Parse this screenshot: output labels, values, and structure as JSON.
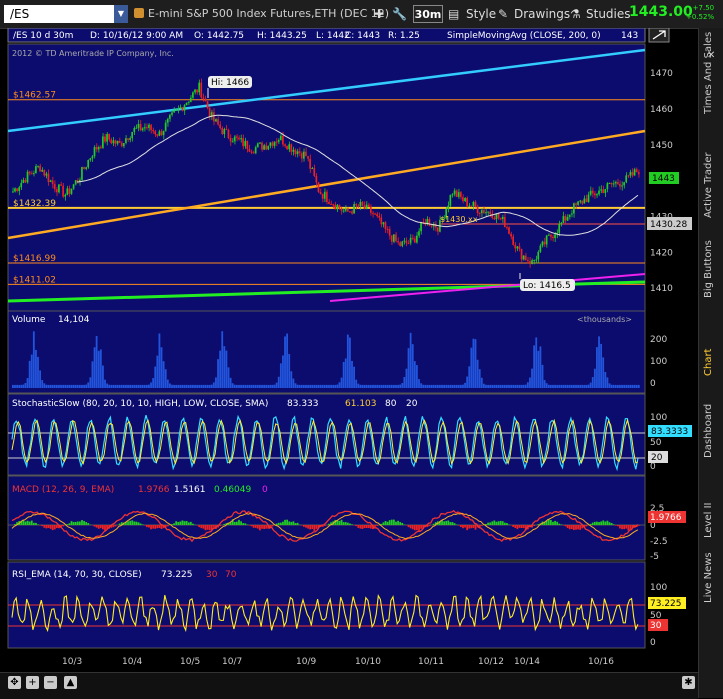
{
  "toolbar": {
    "symbol": "/ES",
    "description": "E-mini S&P 500 Index Futures,ETH (DEC 12)",
    "timeframe": "30m",
    "style_label": "Style",
    "drawings_label": "Drawings",
    "studies_label": "Studies",
    "last_price": "1443.00",
    "change": "+7.50",
    "change_pct": "+0.52%"
  },
  "header_bar": {
    "chart_id": "/ES 10 d 30m",
    "date": "D: 10/16/12 9:00 AM",
    "open": "O: 1442.75",
    "high": "H: 1443.25",
    "low": "L: 1442",
    "close": "C: 1443",
    "range": "R: 1.25",
    "study": "SimpleMovingAvg (CLOSE, 200, 0)",
    "study_value": "143"
  },
  "copyright": "2012 © TD Ameritrade IP Company, Inc.",
  "price_panel": {
    "ylim": [
      1405,
      1477
    ],
    "ticks": [
      1410,
      1420,
      1430,
      1440,
      1450,
      1460,
      1470
    ],
    "hi_label": "Hi: 1466",
    "lo_label": "Lo: 1416.5",
    "levels": [
      {
        "label": "$1462.57",
        "value": 1462.57,
        "color": "#ff8c1a"
      },
      {
        "label": "$1432.39",
        "value": 1432.39,
        "color": "#ffcc33"
      },
      {
        "label": "$1416.99",
        "value": 1416.99,
        "color": "#ff8c1a"
      },
      {
        "label": "$1411.02",
        "value": 1411.02,
        "color": "#ff8c1a"
      }
    ],
    "mid_label": "$1430.xx",
    "current_badge": "1443",
    "sma_badge": "1430.28"
  },
  "volume_panel": {
    "title": "Volume",
    "value": "14,104",
    "units": "<thousands>",
    "ticks": [
      "200",
      "100",
      "0"
    ]
  },
  "stoch_panel": {
    "title": "StochasticSlow (80, 20, 10, 10, HIGH, LOW, CLOSE, SMA)",
    "k": "83.333",
    "d": "61.103",
    "ob": "80",
    "os": "20",
    "badge_k": "83.3333",
    "badge_os": "20",
    "ticks": [
      "100",
      "50",
      "0"
    ]
  },
  "macd_panel": {
    "title": "MACD (12, 26, 9, EMA)",
    "value": "1.9766",
    "avg": "1.5161",
    "diff": "0.46049",
    "zero": "0",
    "badge": "1.9766",
    "ticks": [
      "2.5",
      "0",
      "-2.5",
      "-5"
    ]
  },
  "rsi_panel": {
    "title": "RSI_EMA (14, 70, 30, CLOSE)",
    "value": "73.225",
    "ob": "30",
    "os": "70",
    "badge": "73.225",
    "badge_os": "30",
    "ticks": [
      "100",
      "50",
      "0"
    ]
  },
  "x_axis": {
    "labels": [
      "10/3",
      "10/4",
      "10/5",
      "10/7",
      "10/9",
      "10/10",
      "10/11",
      "10/12",
      "10/14",
      "10/16"
    ]
  },
  "right_tabs": [
    "Times And Sales",
    "Active Trader",
    "Big Buttons",
    "Chart",
    "Dashboard",
    "Level II",
    "Live News"
  ],
  "colors": {
    "panel_bg": "#0c0c6e",
    "up": "#22cc22",
    "down": "#ee2222",
    "sma": "#e0e0e0",
    "cyan_trend": "#33ccff",
    "orange_trend": "#ffaa22",
    "green_line": "#22ee22",
    "magenta_line": "#ee22ee"
  },
  "chart_data": [
    {
      "type": "line",
      "title": "",
      "series": [
        {
          "name": "",
          "values": [
            1437,
            1441,
            1444,
            1439,
            1436,
            1441,
            1448,
            1452,
            1450,
            1454,
            1455,
            1453,
            1458,
            1462,
            1466,
            1457,
            1453,
            1451,
            1449,
            1450,
            1452,
            1449,
            1447,
            1437,
            1434,
            1431,
            1433,
            1431,
            1426,
            1422,
            1423,
            1429,
            1427,
            1437,
            1434,
            1432,
            1431,
            1428,
            1420,
            1417,
            1423,
            1427,
            1432,
            1435,
            1437,
            1439,
            1440,
            1443
          ]
        }
      ],
      "ylim": [
        1405,
        1477
      ]
    }
  ]
}
